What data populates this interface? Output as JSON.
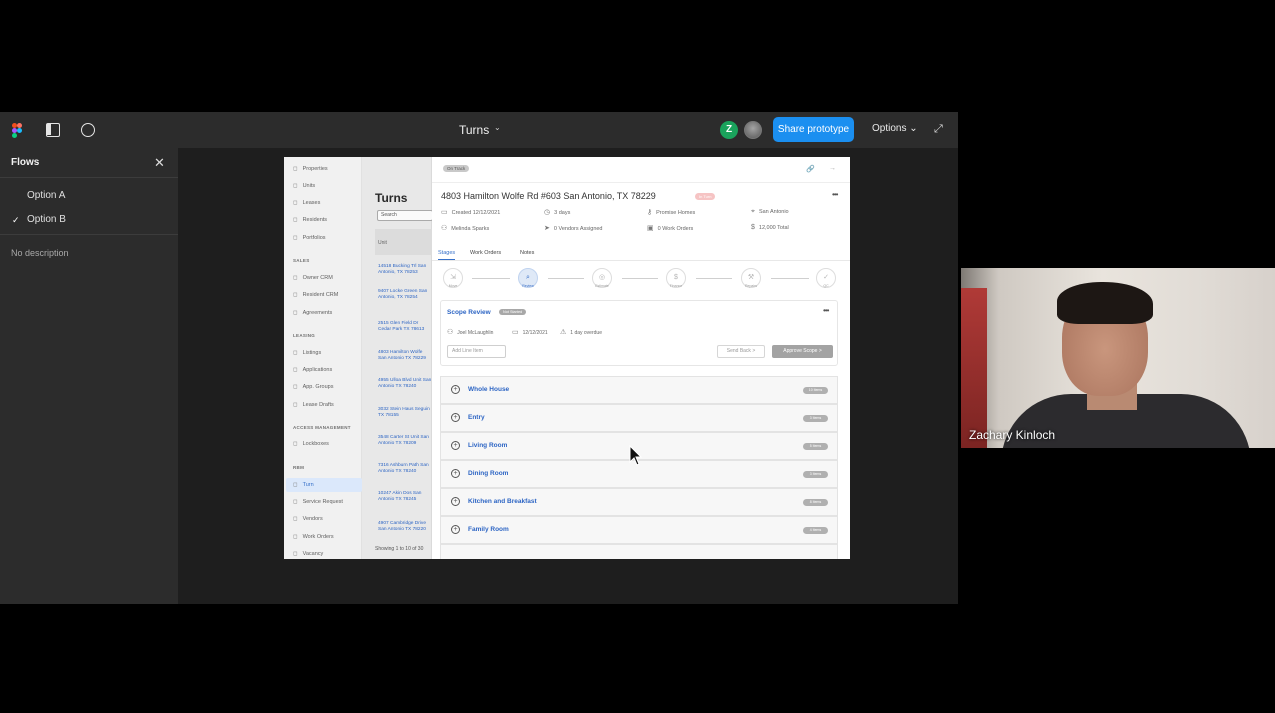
{
  "figma": {
    "file_title": "Turns",
    "title_caret": "⌄",
    "avatar_initial": "Z",
    "share_label": "Share prototype",
    "options_label": "Options ⌄"
  },
  "flows": {
    "title": "Flows",
    "items": [
      "Option A",
      "Option B"
    ],
    "selected": "Option B",
    "description": "No description"
  },
  "proto": {
    "sidebar": {
      "items_main": [
        "Properties",
        "Units",
        "Leases",
        "Residents",
        "Portfolios"
      ],
      "heading_sales": "SALES",
      "items_sales": [
        "Owner CRM",
        "Resident CRM",
        "Agreements"
      ],
      "heading_leasing": "LEASING",
      "items_leasing": [
        "Listings",
        "Applications",
        "App. Groups",
        "Lease Drafts"
      ],
      "heading_access": "ACCESS MANAGEMENT",
      "items_access": [
        "Lockboxes"
      ],
      "heading_rbm": "RBM",
      "items_rbm": [
        "Turn",
        "Service Request",
        "Vendors",
        "Work Orders",
        "Vacancy"
      ]
    },
    "list": {
      "title": "Turns",
      "search_placeholder": "Search",
      "column_header": "Unit",
      "rows": [
        "14518 Bucking Trl San Antonio, TX 78253",
        "9407 Locke Green San Antonio, TX 78254",
        "2515 Glen Field Dr Cedar Park TX 78613",
        "4803 Hamilton Wolfe San Antonio TX 78229",
        "4955 Ulloa Blvd Unit San Antonio TX 78240",
        "3032 Stein Haus Seguin TX 78155",
        "3548 Carter St Unit San Antonio TX 78209",
        "7316 Ashburn Path San Antonio TX 78240",
        "10247 Akin Dos San Antonio TX 78245",
        "4907 Cambridge Drive San Antonio TX 78220"
      ],
      "footer": "Showing 1 to 10 of 30"
    },
    "detail": {
      "status": "On Track",
      "address": "4803 Hamilton Wolfe Rd #603 San Antonio, TX 78229",
      "badge": "In Turn",
      "meta": {
        "created": "Created 12/12/2021",
        "days": "3 days",
        "owner": "Promise Homes",
        "market": "San Antonio",
        "assignee": "Melinda Sparks",
        "vendors": "0 Vendors Assigned",
        "work_orders": "0 Work Orders",
        "total": "12,000 Total"
      },
      "tabs": [
        "Stages",
        "Work Orders",
        "Notes"
      ],
      "stages": [
        "Move",
        "Review",
        "Estimate",
        "Finance",
        "Repairs",
        "QC"
      ],
      "scope": {
        "title": "Scope Review",
        "status": "Not Started",
        "assignee": "Joel McLaughlin",
        "date": "12/12/2021",
        "overdue": "1 day overdue",
        "add_line": "Add Line Item",
        "send_back": "Send Back >",
        "approve": "Approve Scope >"
      },
      "rooms": [
        {
          "name": "Whole House",
          "badge": "10 Items"
        },
        {
          "name": "Entry",
          "badge": "3 Items"
        },
        {
          "name": "Living Room",
          "badge": "5 Items"
        },
        {
          "name": "Dining Room",
          "badge": "3 Items"
        },
        {
          "name": "Kitchen and Breakfast",
          "badge": "8 Items"
        },
        {
          "name": "Family Room",
          "badge": "4 Items"
        }
      ]
    }
  },
  "webcam": {
    "name": "Zachary Kinloch"
  },
  "icons": {
    "logo": "figma-logo-icon",
    "sidebar": "sidebar-toggle-icon",
    "comment": "comment-icon",
    "expand": "expand-icon",
    "close": "close-icon",
    "check": "check-icon"
  },
  "colors": {
    "share_button": "#1b8ff0",
    "avatar": "#1aa35c",
    "link_blue": "#2d65c4"
  }
}
